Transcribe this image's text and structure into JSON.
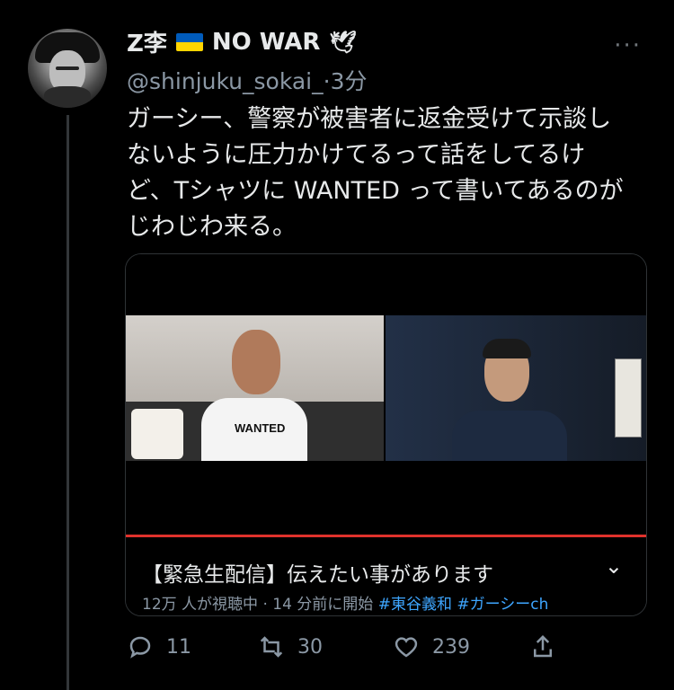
{
  "tweet": {
    "display_name": "Z李",
    "display_name_suffix": "NO WAR",
    "dove_icon": "🕊",
    "handle": "@shinjuku_sokai_",
    "separator": "·",
    "time": "3分",
    "more_label": "···",
    "text": "ガーシー、警察が被害者に返金受けて示談し\nないように圧力かけてるって話をしてるけ\nど、Tシャツに WANTED って書いてあるのが\nじわじわ来る。"
  },
  "video_card": {
    "shirt_text": "WANTED",
    "title": "【緊急生配信】伝えたい事があります",
    "chevron_icon": "⌄",
    "meta": "12万 人が視聴中 · 14 分前に開始",
    "tags": [
      "#東谷義和",
      "#ガーシーch"
    ]
  },
  "actions": {
    "reply_count": "11",
    "retweet_count": "30",
    "like_count": "239"
  },
  "colors": {
    "background": "#000000",
    "text": "#e7e9ea",
    "secondary_text": "#8b98a5",
    "link": "#3ea6ff",
    "progress": "#e0322c"
  }
}
